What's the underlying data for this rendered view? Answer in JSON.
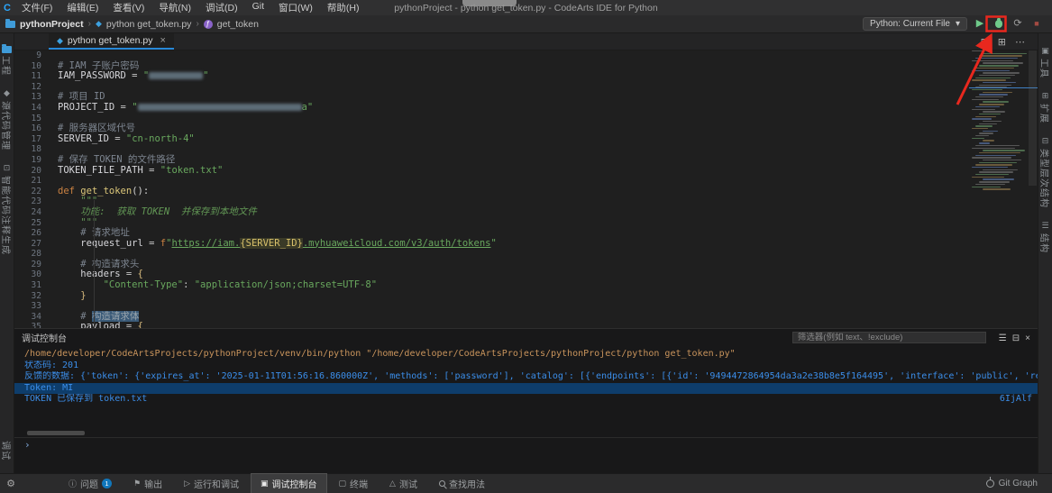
{
  "titlebar": {
    "title": "pythonProject - python get_token.py - CodeArts IDE for Python",
    "logo": "C",
    "menus": [
      "文件(F)",
      "编辑(E)",
      "查看(V)",
      "导航(N)",
      "调试(D)",
      "Git",
      "窗口(W)",
      "帮助(H)"
    ]
  },
  "breadcrumb": {
    "project": "pythonProject",
    "file": "python get_token.py",
    "symbol": "get_token",
    "separator": "›",
    "symbol_glyph": "ƒ"
  },
  "run_toolbar": {
    "config": "Python: Current File",
    "caret": "▾",
    "run_glyph": "▶",
    "restart_glyph": "⟳",
    "stop_glyph": "■"
  },
  "tabbar": {
    "active_tab": "python get_token.py",
    "tab_icon": "◆",
    "close": "×",
    "actions": [
      "⊡",
      "⊞",
      "⋯"
    ]
  },
  "sidebar_left": {
    "items": [
      {
        "icon": "folder",
        "glyph": "",
        "label": "工程"
      },
      {
        "icon": "diamond",
        "glyph": "◆",
        "label": "源代码管理"
      },
      {
        "icon": "comment",
        "glyph": "⊡",
        "label": "智能代码注释生成"
      }
    ],
    "bottom_item": {
      "icon": "bug",
      "glyph": "",
      "label": "调试"
    }
  },
  "sidebar_right": {
    "items": [
      {
        "icon": "tools",
        "glyph": "▣",
        "label": "工具"
      },
      {
        "icon": "extensions",
        "glyph": "⊞",
        "label": "扩展"
      },
      {
        "icon": "hierarchy",
        "glyph": "⊟",
        "label": "类型层次结构"
      },
      {
        "icon": "structure",
        "glyph": "☰",
        "label": "结构"
      }
    ]
  },
  "editor": {
    "lines": [
      {
        "n": 9,
        "s": []
      },
      {
        "n": 10,
        "s": [
          {
            "c": "cm",
            "t": "# IAM 子账户密码"
          }
        ]
      },
      {
        "n": 11,
        "s": [
          {
            "c": "v",
            "t": "IAM_PASSWORD"
          },
          {
            "c": "o",
            "t": " = "
          },
          {
            "c": "s",
            "t": "\""
          },
          {
            "c": "red",
            "w": 60
          },
          {
            "c": "s",
            "t": "\""
          }
        ]
      },
      {
        "n": 12,
        "s": []
      },
      {
        "n": 13,
        "s": [
          {
            "c": "cm",
            "t": "# 项目 ID"
          }
        ]
      },
      {
        "n": 14,
        "s": [
          {
            "c": "v",
            "t": "PROJECT_ID"
          },
          {
            "c": "o",
            "t": " = "
          },
          {
            "c": "s",
            "t": "\""
          },
          {
            "c": "red",
            "w": 182
          },
          {
            "c": "s",
            "t": "a\""
          }
        ]
      },
      {
        "n": 15,
        "s": []
      },
      {
        "n": 16,
        "s": [
          {
            "c": "cm",
            "t": "# 服务器区域代号"
          }
        ]
      },
      {
        "n": 17,
        "s": [
          {
            "c": "v",
            "t": "SERVER_ID"
          },
          {
            "c": "o",
            "t": " = "
          },
          {
            "c": "s",
            "t": "\"cn-north-4\""
          }
        ]
      },
      {
        "n": 18,
        "s": []
      },
      {
        "n": 19,
        "s": [
          {
            "c": "cm",
            "t": "# 保存 TOKEN 的文件路径"
          }
        ]
      },
      {
        "n": 20,
        "s": [
          {
            "c": "v",
            "t": "TOKEN_FILE_PATH"
          },
          {
            "c": "o",
            "t": " = "
          },
          {
            "c": "s",
            "t": "\"token.txt\""
          }
        ]
      },
      {
        "n": 21,
        "s": []
      },
      {
        "n": 22,
        "s": [
          {
            "c": "k",
            "t": "def "
          },
          {
            "c": "f",
            "t": "get_token"
          },
          {
            "c": "pn",
            "t": "():"
          }
        ]
      },
      {
        "n": 23,
        "s": [
          {
            "c": "doc",
            "t": "    \"\"\""
          }
        ]
      },
      {
        "n": 24,
        "s": [
          {
            "c": "doc",
            "t": "    功能:  获取 TOKEN  并保存到本地文件"
          }
        ]
      },
      {
        "n": 25,
        "s": [
          {
            "c": "doc",
            "t": "    \"\"\""
          }
        ]
      },
      {
        "n": 26,
        "s": [
          {
            "c": "cm",
            "t": "    # 请求地址"
          }
        ]
      },
      {
        "n": 27,
        "s": [
          {
            "c": "v",
            "t": "    request_url"
          },
          {
            "c": "o",
            "t": " = "
          },
          {
            "c": "k",
            "t": "f"
          },
          {
            "c": "s",
            "t": "\""
          },
          {
            "c": "su",
            "t": "https://iam."
          },
          {
            "c": "fb",
            "t": "{SERVER_ID}"
          },
          {
            "c": "su",
            "t": ".myhuaweicloud.com/v3/auth/tokens"
          },
          {
            "c": "s",
            "t": "\""
          }
        ]
      },
      {
        "n": 28,
        "s": []
      },
      {
        "n": 29,
        "s": [
          {
            "c": "cm",
            "t": "    # 构造请求头"
          }
        ]
      },
      {
        "n": 30,
        "s": [
          {
            "c": "v",
            "t": "    headers"
          },
          {
            "c": "o",
            "t": " = "
          },
          {
            "c": "gold",
            "t": "{"
          }
        ]
      },
      {
        "n": 31,
        "s": [
          {
            "c": "s",
            "t": "        \"Content-Type\""
          },
          {
            "c": "o",
            "t": ": "
          },
          {
            "c": "s",
            "t": "\"application/json;charset=UTF-8\""
          }
        ]
      },
      {
        "n": 32,
        "s": [
          {
            "c": "gold",
            "t": "    }"
          }
        ]
      },
      {
        "n": 33,
        "s": []
      },
      {
        "n": 34,
        "s": [
          {
            "c": "cm",
            "t": "    # "
          },
          {
            "c": "cmh",
            "t": "构造请求体"
          }
        ]
      },
      {
        "n": 35,
        "s": [
          {
            "c": "v",
            "t": "    payload"
          },
          {
            "c": "o",
            "t": " = "
          },
          {
            "c": "gold",
            "t": "{"
          }
        ]
      }
    ]
  },
  "debug_console": {
    "title": "调试控制台",
    "filter_placeholder": "筛选器(例如 text、!exclude)",
    "header_icons": [
      "☰",
      "⊟",
      "×"
    ],
    "lines": [
      {
        "cls": "cmd",
        "text": "/home/developer/CodeArtsProjects/pythonProject/venv/bin/python \"/home/developer/CodeArtsProjects/pythonProject/python get_token.py\""
      },
      {
        "cls": "out",
        "text": "状态码: 201"
      },
      {
        "cls": "out",
        "text": "反馈的数据: {'token': {'expires_at': '2025-01-11T01:56:16.860000Z', 'methods': ['password'], 'catalog': [{'endpoints': [{'id': '9494472864954da3a2e38b8e5f164495', 'interface': 'public', 'region': 'cn-north-4', 'region_id': 'cn-north-4', 'url': 'https://iota.cn"
      },
      {
        "cls": "out",
        "sel": true,
        "text": "Token: MI"
      },
      {
        "cls": "out",
        "text": "TOKEN 已保存到 token.txt",
        "right": "6IjAlf"
      }
    ],
    "prompt": "›"
  },
  "bottom_bar": {
    "tabs": [
      {
        "icon": "info",
        "glyph": "ⓘ",
        "label": "问题",
        "badge": "1"
      },
      {
        "icon": "flag",
        "glyph": "⚑",
        "label": "输出"
      },
      {
        "icon": "run",
        "glyph": "▷",
        "label": "运行和调试"
      },
      {
        "icon": "console",
        "glyph": "▣",
        "label": "调试控制台",
        "active": true
      },
      {
        "icon": "terminal",
        "glyph": "▢",
        "label": "终端"
      },
      {
        "icon": "test",
        "glyph": "△",
        "label": "测试"
      },
      {
        "icon": "search",
        "glyph": "",
        "label": "查找用法"
      }
    ],
    "right_label": "Git Graph",
    "gear_glyph": "⚙"
  },
  "colors": {
    "accent_blue": "#2788d8",
    "annotation_red": "#e8281e",
    "console_blue": "#3b8eea",
    "console_command": "#c9945c",
    "string_green": "#69a85e",
    "keyword_orange": "#cc8242",
    "run_green": "#6fc98a",
    "badge_blue": "#1177bb",
    "selection_row": "#0e3d6b"
  }
}
